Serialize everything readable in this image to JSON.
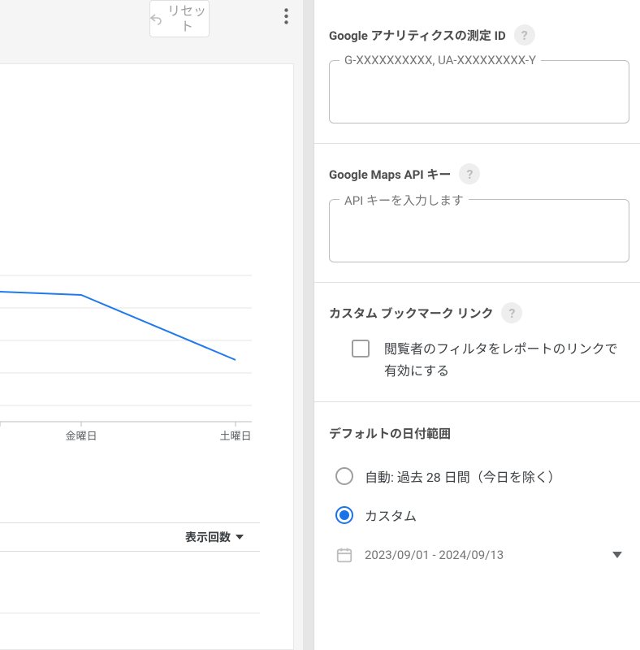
{
  "toolbar": {
    "reset_label": "リセット"
  },
  "chart_data": {
    "type": "line",
    "categories": [
      "",
      "金曜日",
      "土曜日"
    ],
    "values": [
      84,
      82,
      40
    ],
    "ylim": [
      0,
      120
    ]
  },
  "left_panel": {
    "axis_friday": "金曜日",
    "axis_saturday": "土曜日",
    "display_count_label": "表示回数"
  },
  "settings": {
    "ga_id": {
      "label": "Google アナリティクスの測定 ID",
      "placeholder": "G-XXXXXXXXXX, UA-XXXXXXXXX-Y",
      "value": ""
    },
    "maps_key": {
      "label": "Google Maps API キー",
      "placeholder": "API キーを入力します",
      "value": ""
    },
    "bookmark": {
      "label": "カスタム ブックマーク リンク",
      "checkbox_label": "閲覧者のフィルタをレポートのリンクで有効にする"
    },
    "date_range": {
      "label": "デフォルトの日付範囲",
      "option_auto": "自動: 過去 28 日間（今日を除く）",
      "option_custom": "カスタム",
      "selected": "custom",
      "range_text": "2023/09/01 - 2024/09/13"
    }
  }
}
